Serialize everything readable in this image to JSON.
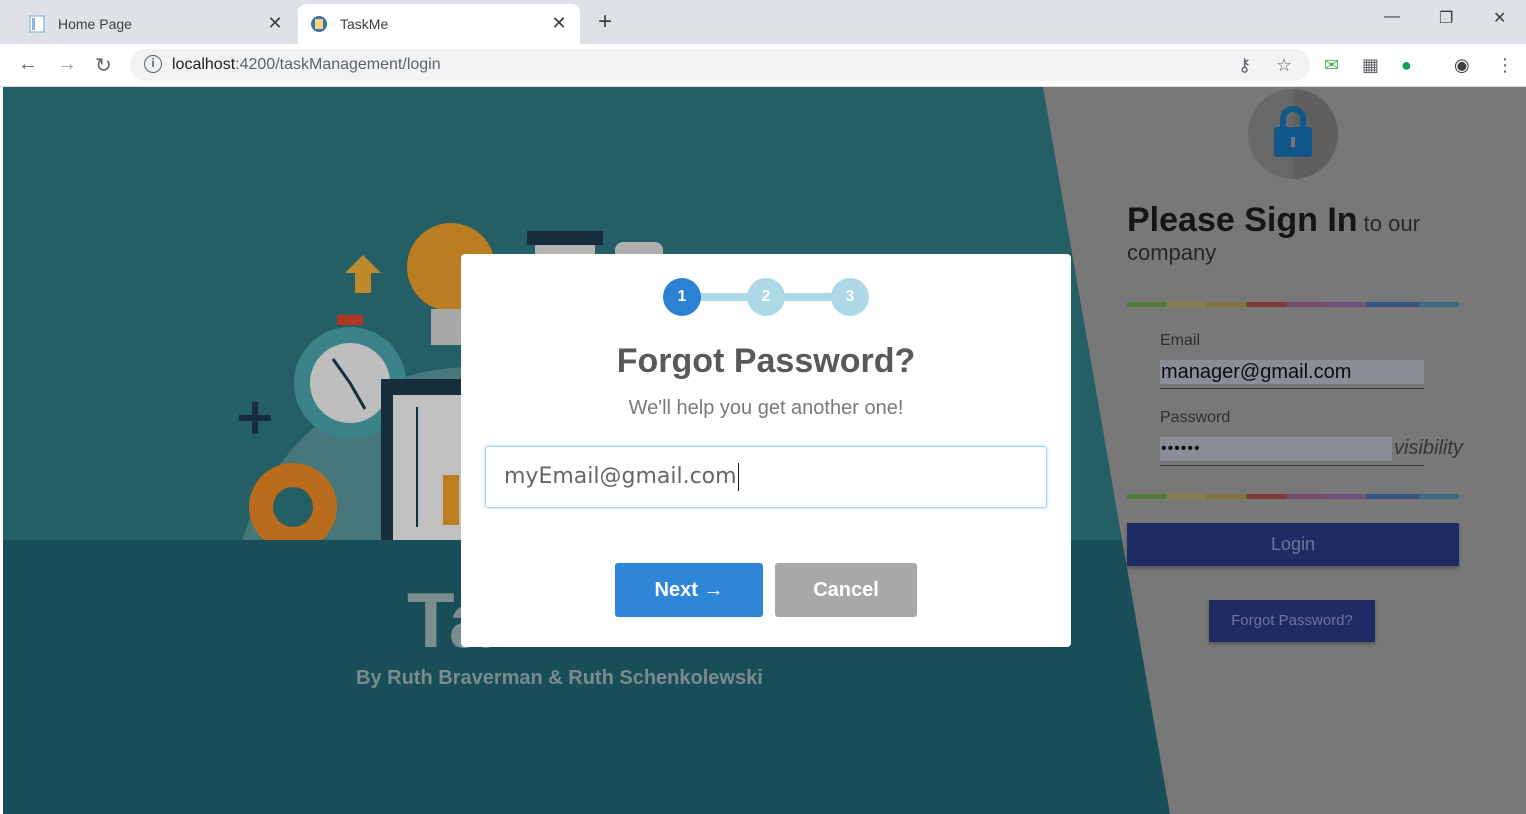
{
  "browser": {
    "tabs": [
      {
        "title": "Home Page",
        "active": false
      },
      {
        "title": "TaskMe",
        "active": true
      }
    ],
    "url_host": "localhost",
    "url_rest": ":4200/taskManagement/login"
  },
  "hero": {
    "brand_partial": "Ta",
    "authors": "By Ruth Braverman & Ruth Schenkolewski"
  },
  "signin_panel": {
    "heading_bold": "Please Sign In",
    "heading_light": " to our company",
    "email_label": "Email",
    "email_value": "manager@gmail.com",
    "password_label": "Password",
    "password_value": "••••••",
    "visibility_toggle": "visibility",
    "login_label": "Login",
    "forgot_label": "Forgot Password?"
  },
  "modal": {
    "steps": [
      "1",
      "2",
      "3"
    ],
    "active_step": 1,
    "title": "Forgot Password?",
    "subtitle": "We'll help you get another one!",
    "email_input_value": "myEmail@gmail.com",
    "next_label": "Next →",
    "cancel_label": "Cancel"
  },
  "colors": {
    "step_active": "#2b82d3",
    "step_inactive": "#add8e6",
    "next_button": "#2f86d8",
    "cancel_button": "#a8a8a8",
    "panel_button": "#2a3680"
  }
}
